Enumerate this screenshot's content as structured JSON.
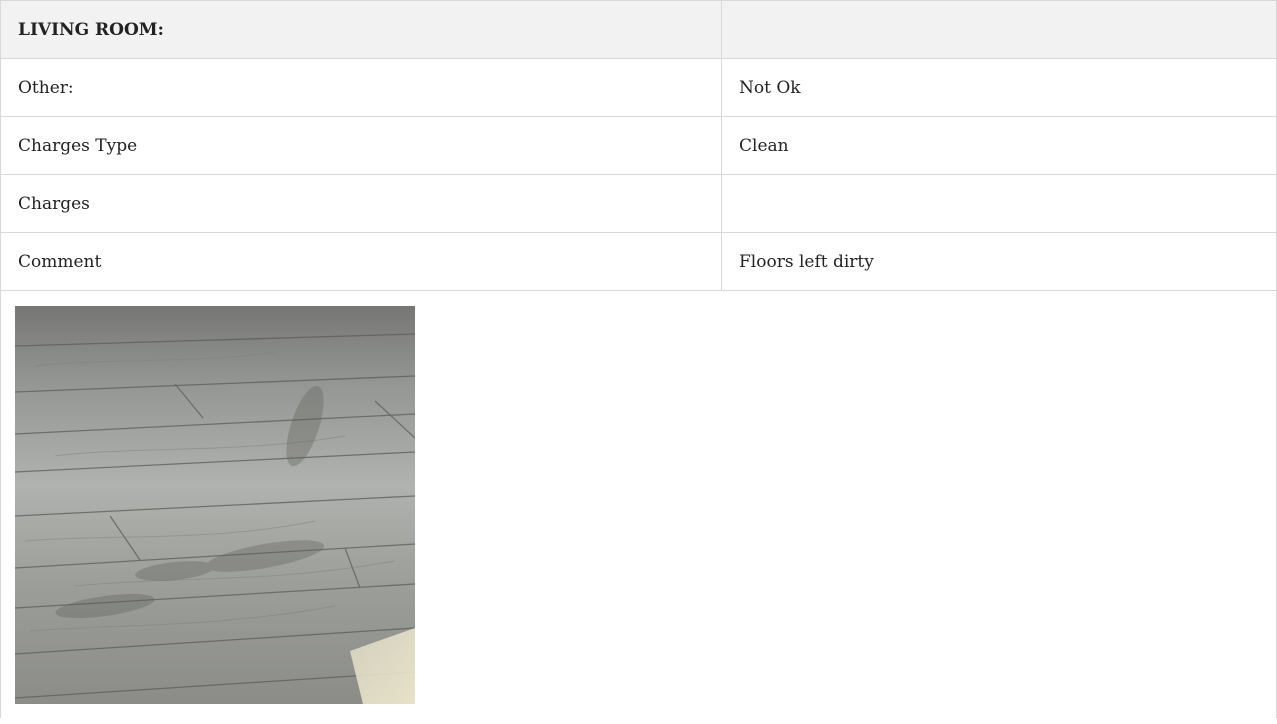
{
  "section": {
    "title": "LIVING ROOM:",
    "title_value": ""
  },
  "rows": [
    {
      "label": "Other:",
      "value": "Not Ok"
    },
    {
      "label": "Charges Type",
      "value": "Clean"
    },
    {
      "label": "Charges",
      "value": ""
    },
    {
      "label": "Comment",
      "value": "Floors left dirty"
    }
  ],
  "photo": {
    "subject": "floor-photo"
  }
}
